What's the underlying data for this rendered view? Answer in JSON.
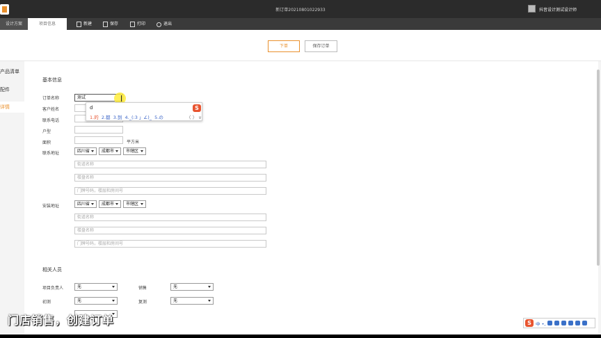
{
  "window": {
    "title": "新订单20210801022933",
    "user_name": "抖音设计测试设计师"
  },
  "menubar": {
    "tab_design": "设计方案",
    "tab_project": "项目信息",
    "new_label": "新建",
    "save_label": "保存",
    "print_label": "打印",
    "exit_label": "退出"
  },
  "actions": {
    "order_label": "下单",
    "save_order_label": "保存订单"
  },
  "sidebar": {
    "items": [
      {
        "label": "产品清单"
      },
      {
        "label": "配件"
      },
      {
        "label": "详情"
      }
    ]
  },
  "basic": {
    "title": "基本信息",
    "order_name_label": "订单名称",
    "order_name_value": "测试",
    "customer_label": "客户姓名",
    "phone_label": "联系电话",
    "house_type_label": "户型",
    "area_label": "面积",
    "area_unit": "平方米",
    "contact_addr_label": "联系地址",
    "province": "四川省",
    "city": "成都市",
    "district": "市辖区",
    "street_placeholder": "街道名称",
    "community_placeholder": "楼盘名称",
    "door_placeholder": "门牌号码，楼层和房间号",
    "install_addr_label": "安装地址"
  },
  "people": {
    "title": "相关人员",
    "pm_label": "项目负责人",
    "pm_value": "无",
    "sales_label": "销售",
    "sales_value": "无",
    "measure_label": "初测",
    "measure_value": "无",
    "review_label": "复测",
    "review_value": "无"
  },
  "ime": {
    "input_text": "d",
    "candidates": [
      "1.的",
      "2.都",
      "3.到",
      "4._(:3 」∠)_",
      "5.の"
    ],
    "nav": "〈 〉 ∨",
    "logo": "S"
  },
  "ime_bar": {
    "logo": "S",
    "mode": "中 •,"
  },
  "subtitle": "门店销售，创建订单",
  "colors": {
    "accent": "#e9902d",
    "titlebar": "#2b2b2b",
    "menubar": "#3a3a3a"
  }
}
